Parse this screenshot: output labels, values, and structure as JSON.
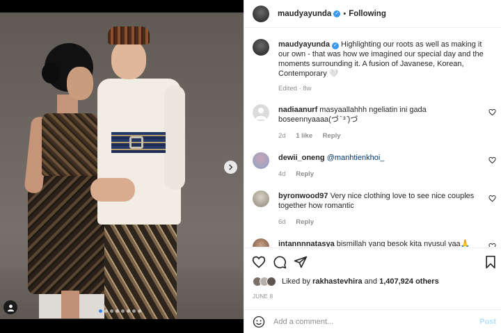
{
  "header": {
    "username": "maudyayunda",
    "separator": "•",
    "follow_status": "Following"
  },
  "caption": {
    "username": "maudyayunda",
    "text": "Highlighting our roots as well as making it our own - that was how we imagined our special day and the moments surrounding it. A fusion of Javanese, Korean, Contemporary 🤍",
    "meta": "Edited · 8w"
  },
  "comments": [
    {
      "username": "nadiaanurf",
      "text": "masyaallahhh ngeliatin ini gada boseennyaaaa(づ ̄ ³ ̄)づ",
      "time": "2d",
      "likes": "1 like",
      "reply": "Reply"
    },
    {
      "username": "dewii_oneng",
      "text": "@manhtienkhoi_",
      "time": "4d",
      "reply": "Reply"
    },
    {
      "username": "byronwood97",
      "text": "Very nice clothing love to see nice couples together how romantic",
      "time": "6d",
      "reply": "Reply"
    },
    {
      "username": "intannnnatasya",
      "text": "bismillah yang besok kita nyusul yaa🙏",
      "time": "",
      "reply": ""
    }
  ],
  "likes": {
    "prefix": "Liked by",
    "user": "rakhastevhira",
    "connector": "and",
    "count": "1,407,924 others"
  },
  "date": "JUNE 8",
  "add_comment": {
    "placeholder": "Add a comment...",
    "post_label": "Post"
  },
  "carousel": {
    "total_slides": 8,
    "active_slide": 1
  },
  "colors": {
    "verified": "#3897f0",
    "link": "#00376b",
    "post_disabled": "#b2dffc",
    "muted": "#8e8e8e"
  },
  "icons": [
    "heart-icon",
    "comment-icon",
    "share-icon",
    "bookmark-icon",
    "emoji-icon",
    "chevron-right-icon",
    "user-tag-icon",
    "verified-badge-icon"
  ]
}
